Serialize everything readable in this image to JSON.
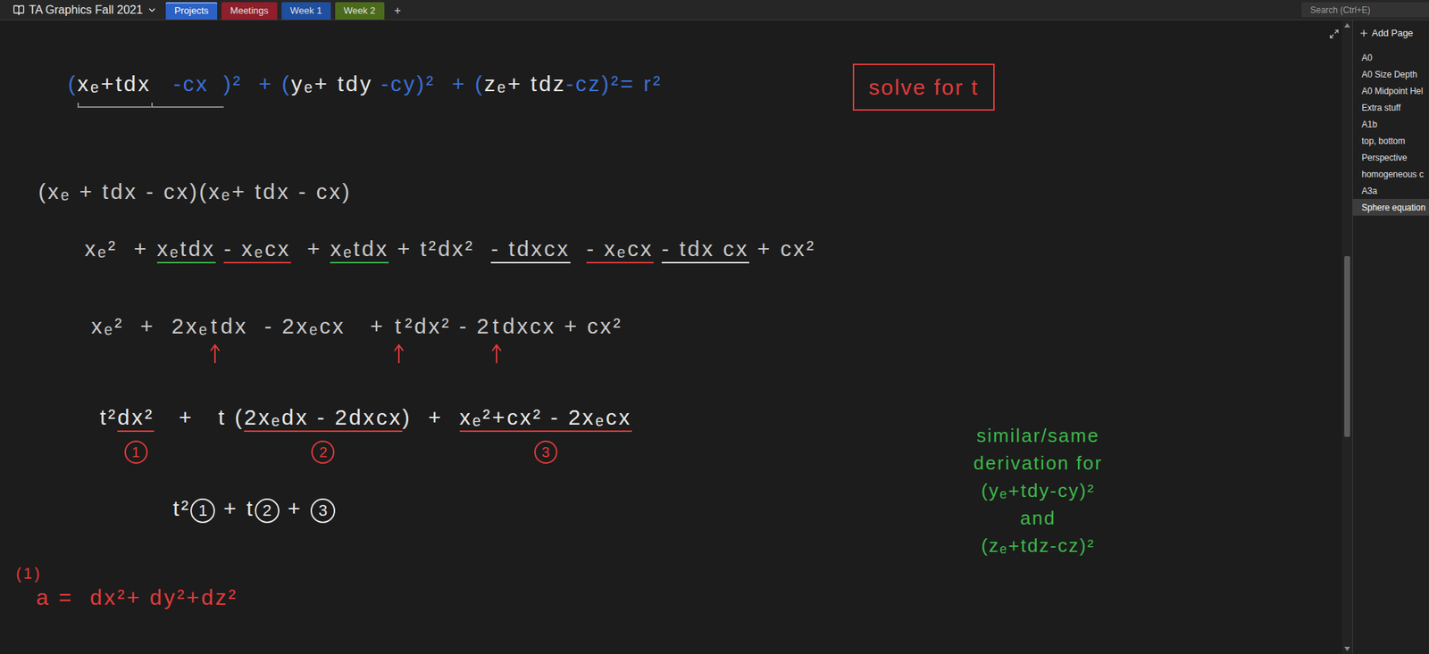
{
  "notebook": {
    "title": "TA Graphics Fall 2021"
  },
  "tabs": [
    {
      "label": "Projects",
      "selected": true,
      "color": "#2b62c4"
    },
    {
      "label": "Meetings",
      "selected": false,
      "color": "#8e1f2b"
    },
    {
      "label": "Week 1",
      "selected": false,
      "color": "#1f4f9e"
    },
    {
      "label": "Week 2",
      "selected": false,
      "color": "#4b6a1c"
    }
  ],
  "new_tab": "+",
  "search": {
    "placeholder": "Search (Ctrl+E)"
  },
  "pages": {
    "add_label": "Add Page",
    "items": [
      {
        "label": "A0",
        "selected": false
      },
      {
        "label": "A0 Size Depth",
        "selected": false
      },
      {
        "label": "A0 Midpoint Hel",
        "selected": false
      },
      {
        "label": "Extra stuff",
        "selected": false
      },
      {
        "label": "A1b",
        "selected": false
      },
      {
        "label": "top, bottom",
        "selected": false
      },
      {
        "label": "Perspective",
        "selected": false
      },
      {
        "label": "homogeneous c",
        "selected": false
      },
      {
        "label": "A3a",
        "selected": false
      },
      {
        "label": "Sphere equation",
        "selected": true
      }
    ]
  },
  "note": {
    "callout": "solve for t",
    "lines": [
      {
        "segments": [
          {
            "text": "(",
            "color": "#3b6fd4"
          },
          {
            "text": "xₑ+tdx",
            "color": "#e6e6e6",
            "brace": "#8a8a8a"
          },
          {
            "text": " -cx",
            "color": "#3b6fd4",
            "brace": "#8a8a8a"
          },
          {
            "text": ")²  + (",
            "color": "#3b6fd4"
          },
          {
            "text": "yₑ+ tdy",
            "color": "#e6e6e6"
          },
          {
            "text": " -cy",
            "color": "#3b6fd4"
          },
          {
            "text": ")²  + (",
            "color": "#3b6fd4"
          },
          {
            "text": "zₑ+ tdz",
            "color": "#e6e6e6"
          },
          {
            "text": "-cz)²= r²",
            "color": "#3b6fd4"
          }
        ]
      },
      {
        "segments": [
          {
            "text": "(xₑ + tdx - cx)(xₑ+ tdx - cx)",
            "color": "#c8c8c8"
          }
        ]
      },
      {
        "segments": [
          {
            "text": "xₑ²  + ",
            "color": "#c8c8c8"
          },
          {
            "text": "xₑtdx",
            "color": "#c8c8c8",
            "underline": "#3db84a"
          },
          {
            "text": " ",
            "color": "#c8c8c8"
          },
          {
            "text": "- xₑcx",
            "color": "#c8c8c8",
            "underline": "#e03b3b"
          },
          {
            "text": "  + ",
            "color": "#c8c8c8"
          },
          {
            "text": "xₑtdx",
            "color": "#c8c8c8",
            "underline": "#3db84a"
          },
          {
            "text": " + t²dx²  ",
            "color": "#c8c8c8"
          },
          {
            "text": "- tdxcx",
            "color": "#c8c8c8",
            "underline": "#e8e8e8"
          },
          {
            "text": "  ",
            "color": "#c8c8c8"
          },
          {
            "text": "- xₑcx",
            "color": "#c8c8c8",
            "underline": "#e03b3b"
          },
          {
            "text": " ",
            "color": "#c8c8c8"
          },
          {
            "text": "- tdx cx",
            "color": "#c8c8c8",
            "underline": "#e8e8e8"
          },
          {
            "text": " + cx²",
            "color": "#c8c8c8"
          }
        ]
      },
      {
        "segments": [
          {
            "text": "xₑ²  +  2xₑ",
            "color": "#c8c8c8"
          },
          {
            "text": "t",
            "color": "#c8c8c8",
            "arrow": true
          },
          {
            "text": "dx  - 2xₑcx   + ",
            "color": "#c8c8c8"
          },
          {
            "text": "t",
            "color": "#c8c8c8",
            "arrow": true
          },
          {
            "text": "²dx² - 2",
            "color": "#c8c8c8"
          },
          {
            "text": "t",
            "color": "#c8c8c8",
            "arrow": true
          },
          {
            "text": "dxcx + cx²",
            "color": "#c8c8c8"
          }
        ]
      },
      {
        "segments": [
          {
            "text": "t²",
            "color": "#e6e6e6"
          },
          {
            "text": "dx²",
            "color": "#e6e6e6",
            "underline": "#e03b3b",
            "label": "1"
          },
          {
            "text": "   +   t (",
            "color": "#e6e6e6"
          },
          {
            "text": "2xₑdx - 2dxcx",
            "color": "#e6e6e6",
            "underline": "#e03b3b",
            "label": "2"
          },
          {
            "text": ")  +  ",
            "color": "#e6e6e6"
          },
          {
            "text": "xₑ²+cx² - 2xₑcx",
            "color": "#e6e6e6",
            "underline": "#e03b3b",
            "label": "3"
          }
        ]
      },
      {
        "segments": [
          {
            "text": "t²",
            "color": "#e6e6e6"
          },
          {
            "text": "1",
            "color": "#e6e6e6",
            "circled": true
          },
          {
            "text": " + t",
            "color": "#e6e6e6"
          },
          {
            "text": "2",
            "color": "#e6e6e6",
            "circled": true
          },
          {
            "text": " + ",
            "color": "#e6e6e6"
          },
          {
            "text": "3",
            "color": "#e6e6e6",
            "circled": true
          }
        ]
      }
    ],
    "side_note": [
      "similar/same",
      "derivation for",
      "(yₑ+tdy-cy)²",
      "and",
      "(zₑ+tdz-cz)²"
    ],
    "footer": [
      {
        "text": "(1)"
      },
      {
        "text": "a =  dx²+ dy²+dz²"
      }
    ]
  }
}
